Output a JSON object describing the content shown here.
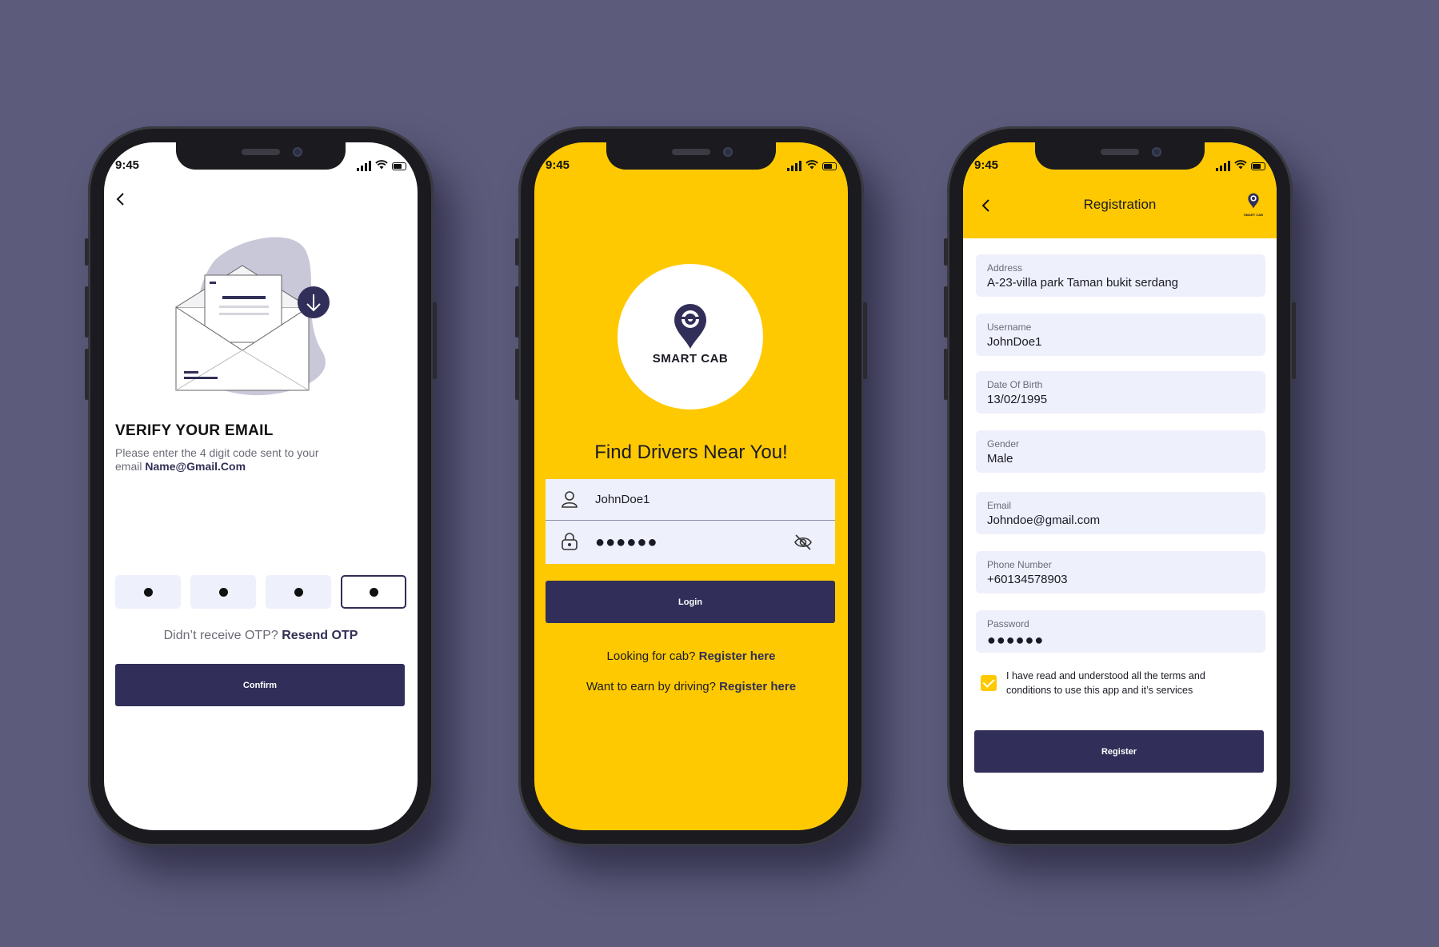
{
  "status_time": "9:45",
  "verify": {
    "title": "VERIFY YOUR EMAIL",
    "desc": "Please enter the 4 digit code sent to your email",
    "email": "Name@Gmail.Com",
    "otp_digits": [
      "•",
      "•",
      "•",
      "•"
    ],
    "resend_prefix": "Didn’t receive OTP?",
    "resend_link": "Resend OTP",
    "confirm_label": "Confirm"
  },
  "login": {
    "logo_text": "SMART CAB",
    "title": "Find Drivers Near You!",
    "username": "JohnDoe1",
    "password": "●●●●●●",
    "login_label": "Login",
    "cab_prefix": "Looking for cab?",
    "cab_link": "Register here",
    "drive_prefix": "Want to earn by driving?",
    "drive_link": "Register here"
  },
  "registration": {
    "title": "Registration",
    "logo_text": "SMART CAB",
    "fields": [
      {
        "label": "Address",
        "value": "A-23-villa park Taman bukit serdang"
      },
      {
        "label": "Username",
        "value": "JohnDoe1"
      },
      {
        "label": "Date Of Birth",
        "value": "13/02/1995"
      },
      {
        "label": "Gender",
        "value": "Male"
      },
      {
        "label": "Email",
        "value": "Johndoe@gmail.com"
      },
      {
        "label": "Phone Number",
        "value": "+60134578903"
      },
      {
        "label": "Password",
        "value": "●●●●●●"
      }
    ],
    "terms": "I have read and understood all the terms and conditions to use this app and it’s services",
    "terms_checked": true,
    "register_label": "Register"
  },
  "colors": {
    "background": "#5c5b7b",
    "accent_yellow": "#fec901",
    "primary_navy": "#312f59",
    "field_bg": "#eef0fb"
  },
  "icons": [
    "back-chevron-icon",
    "user-icon",
    "lock-icon",
    "eye-off-icon",
    "download-icon",
    "map-pin-steering-icon",
    "signal-icon",
    "wifi-icon",
    "battery-icon",
    "check-icon"
  ]
}
